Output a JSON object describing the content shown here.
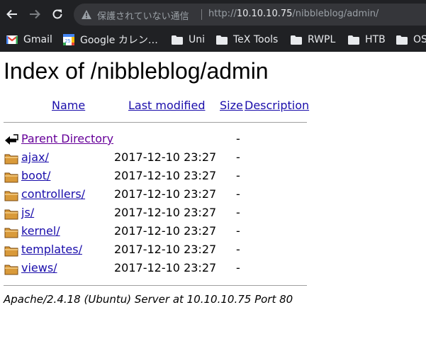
{
  "browser": {
    "security_label": "保護されていない通信",
    "url_prefix": "http://",
    "url_host": "10.10.10.75",
    "url_path": "/nibbleblog/admin/",
    "bookmarks": [
      {
        "label": "Gmail",
        "icon": "gmail-icon"
      },
      {
        "label": "Google カレン…",
        "icon": "google-calendar-icon"
      },
      {
        "label": "Uni",
        "icon": "folder-icon"
      },
      {
        "label": "TeX Tools",
        "icon": "folder-icon"
      },
      {
        "label": "RWPL",
        "icon": "folder-icon"
      },
      {
        "label": "HTB",
        "icon": "folder-icon"
      },
      {
        "label": "OS",
        "icon": "folder-icon"
      }
    ]
  },
  "page": {
    "title": "Index of /nibbleblog/admin",
    "headers": {
      "name": "Name",
      "last_modified": "Last modified",
      "size": "Size",
      "description": "Description"
    },
    "parent": {
      "name": "Parent Directory",
      "size": "-"
    },
    "entries": [
      {
        "name": "ajax/",
        "modified": "2017-12-10 23:27",
        "size": "-"
      },
      {
        "name": "boot/",
        "modified": "2017-12-10 23:27",
        "size": "-"
      },
      {
        "name": "controllers/",
        "modified": "2017-12-10 23:27",
        "size": "-"
      },
      {
        "name": "js/",
        "modified": "2017-12-10 23:27",
        "size": "-"
      },
      {
        "name": "kernel/",
        "modified": "2017-12-10 23:27",
        "size": "-"
      },
      {
        "name": "templates/",
        "modified": "2017-12-10 23:27",
        "size": "-"
      },
      {
        "name": "views/",
        "modified": "2017-12-10 23:27",
        "size": "-"
      }
    ],
    "footer": "Apache/2.4.18 (Ubuntu) Server at 10.10.10.75 Port 80"
  }
}
